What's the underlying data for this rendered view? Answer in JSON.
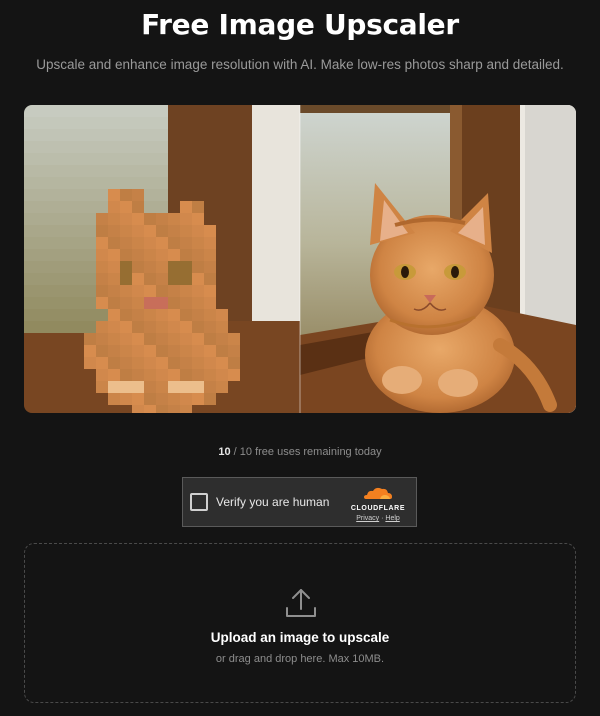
{
  "header": {
    "title": "Free Image Upscaler",
    "subtitle": "Upscale and enhance image resolution with AI. Make low-res photos sharp and detailed."
  },
  "comparison": {
    "before_label": "Pixelated cat photo",
    "after_label": "Upscaled sharp cat photo"
  },
  "usage": {
    "used": "10",
    "rest": " / 10 free uses remaining today"
  },
  "captcha": {
    "label": "Verify you are human",
    "brand": "CLOUDFLARE",
    "privacy": "Privacy",
    "separator": " · ",
    "help": "Help",
    "brand_color": "#f38020"
  },
  "upload": {
    "title": "Upload an image to upscale",
    "subtitle": "or drag and drop here. Max 10MB.",
    "icon": "upload-icon"
  },
  "colors": {
    "background": "#141414",
    "text_muted": "#9a9a9a"
  }
}
